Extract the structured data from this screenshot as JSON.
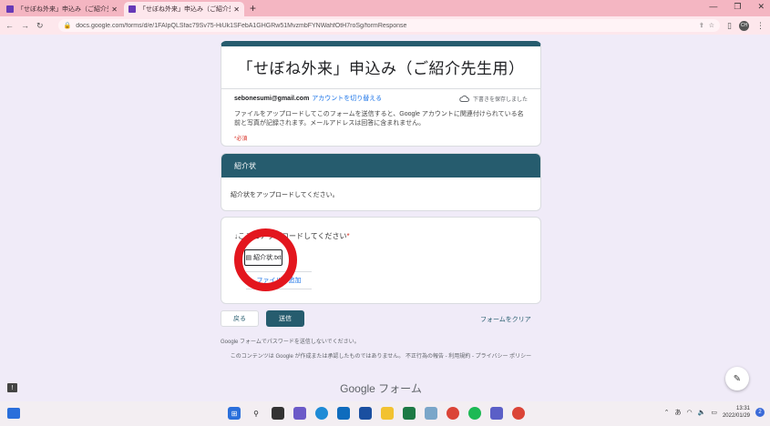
{
  "browser": {
    "tabs": [
      {
        "title": "「せぼね外来」申込み（ご紹介先生",
        "active": false
      },
      {
        "title": "「せぼね外来」申込み（ご紹介先生",
        "active": true
      }
    ],
    "new_tab": "+",
    "url": "docs.google.com/forms/d/e/1FAIpQLSfac79Sv75-HiUk1SFebA1GHGRw51MvzmbFYNWahfOtH7roSg/formResponse",
    "profile": "CH"
  },
  "form": {
    "title": "「せぼね外来」申込み（ご紹介先生用）",
    "account_email": "sebonesumi@gmail.com",
    "switch_account": "アカウントを切り替える",
    "draft_saved": "下書きを保存しました",
    "description": "ファイルをアップロードしてこのフォームを送信すると、Google アカウントに関連付けられている名前と写真が記録されます。メールアドレスは回答に含まれません。",
    "required_note": "*必須",
    "section_title": "紹介状",
    "section_desc": "紹介状をアップロードしてください。",
    "question_title": "↓ここにアップロードしてください",
    "question_star": "*",
    "file_name": "紹介状.txt",
    "add_file": "ファイルを追加",
    "back_button": "戻る",
    "submit_button": "送信",
    "clear_form": "フォームをクリア",
    "password_note": "Google フォームでパスワードを送信しないでください。",
    "disclaimer": "このコンテンツは Google が作成または承認したものではありません。 不正行為の報告 - 利用規約 - プライバシー ポリシー",
    "footer_brand": "Google フォーム"
  },
  "taskbar": {
    "time": "13:31",
    "date": "2022/01/29",
    "ime": "あ",
    "notification_count": "2"
  },
  "colors": {
    "theme": "#265c6e",
    "background": "#f0ebf8",
    "annotation": "#e3161e",
    "tabbar": "#f4b6c2"
  }
}
